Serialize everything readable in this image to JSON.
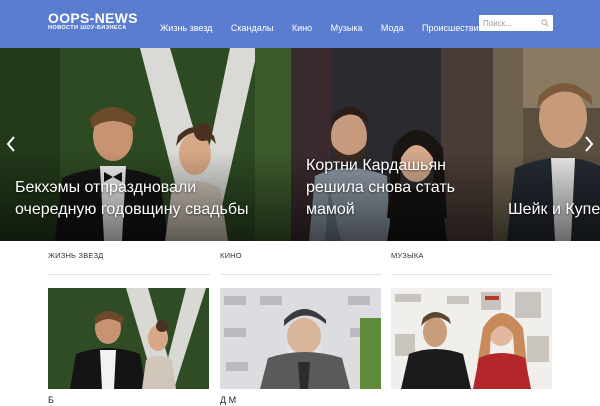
{
  "header": {
    "logo_main": "OOPS-NEWS",
    "logo_sub": "НОВОСТИ ШОУ-БИЗНЕСА",
    "nav": [
      "Жизнь звезд",
      "Скандалы",
      "Кино",
      "Музыка",
      "Мода",
      "Происшествия"
    ],
    "search_placeholder": "Поиск...",
    "colors": {
      "bar": "#5b7dcf",
      "text": "#ffffff"
    }
  },
  "slider": {
    "slides": [
      {
        "title": "Бекхэмы отпраздновали очередную годовщину свадьбы"
      },
      {
        "title": "Кортни Кардашьян решила снова стать мамой"
      },
      {
        "title": "Шейк и Купер ребенка"
      }
    ],
    "prev_icon": "chevron-left-icon",
    "next_icon": "chevron-right-icon"
  },
  "categories": [
    {
      "label": "ЖИЗНЬ ЗВЕЗД",
      "caption": "Б"
    },
    {
      "label": "КИНО",
      "caption": "Д М"
    },
    {
      "label": "МУЗЫКА",
      "caption": ""
    }
  ]
}
